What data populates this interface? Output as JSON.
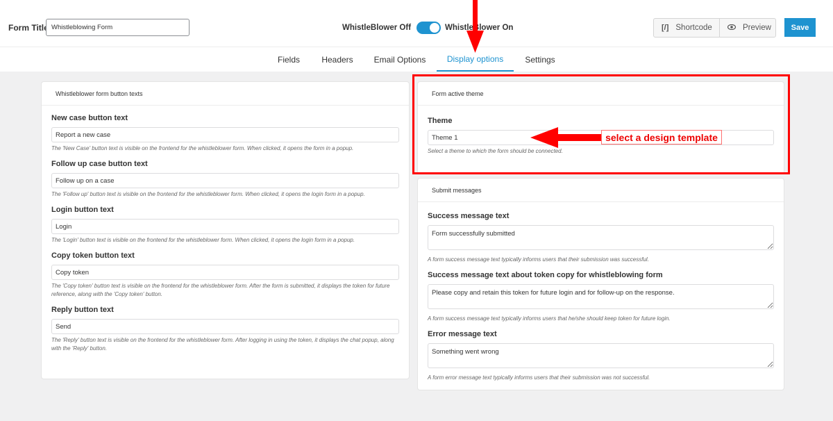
{
  "header": {
    "form_title_label": "Form Title",
    "form_title_value": "Whistleblowing Form",
    "toggle_off_label": "WhistleBlower Off",
    "toggle_on_label": "WhistleBlower On",
    "toggle_state": "on",
    "shortcode_icon": "[/]",
    "shortcode_label": "Shortcode",
    "preview_icon": "eye-icon",
    "preview_label": "Preview",
    "save_label": "Save"
  },
  "tabs": [
    {
      "label": "Fields",
      "active": false
    },
    {
      "label": "Headers",
      "active": false
    },
    {
      "label": "Email Options",
      "active": false
    },
    {
      "label": "Display options",
      "active": true
    },
    {
      "label": "Settings",
      "active": false
    }
  ],
  "button_texts": {
    "title": "Whistleblower form button texts",
    "fields": [
      {
        "label": "New case button text",
        "value": "Report a new case",
        "help": "The 'New Case' button text is visible on the frontend for the whistleblower form. When clicked, it opens the form in a popup."
      },
      {
        "label": "Follow up case button text",
        "value": "Follow up on a case",
        "help": "The 'Follow up' button text is visible on the frontend for the whistleblower form. When clicked, it opens the login form in a popup."
      },
      {
        "label": "Login button text",
        "value": "Login",
        "help": "The 'Login' button text is visible on the frontend for the whistleblower form. When clicked, it opens the login form in a popup."
      },
      {
        "label": "Copy token button text",
        "value": "Copy token",
        "help": "The 'Copy token' button text is visible on the frontend for the whistleblower form. After the form is submitted, it displays the token for future reference, along with the 'Copy token' button."
      },
      {
        "label": "Reply button text",
        "value": "Send",
        "help": "The 'Reply' button text is visible on the frontend for the whistleblower form. After logging in using the token, it displays the chat popup, along with the 'Reply' button."
      }
    ]
  },
  "theme": {
    "title": "Form active theme",
    "label": "Theme",
    "value": "Theme 1",
    "help": "Select a theme to which the form should be connected."
  },
  "submit_messages": {
    "title": "Submit messages",
    "fields": [
      {
        "label": "Success message text",
        "value": "Form successfully submitted",
        "help": "A form success message text typically informs users that their submission was successful."
      },
      {
        "label": "Success message text about token copy for whistleblowing form",
        "value": "Please copy and retain this token for future login and for follow-up on the response.",
        "help": "A form success message text typically informs users that he/she should keep token for future login."
      },
      {
        "label": "Error message text",
        "value": "Something went wrong",
        "help": "A form error message text typically informs users that their submission was not successful."
      }
    ]
  },
  "annotation": {
    "label": "select a design template",
    "color": "#ff0000"
  },
  "colors": {
    "accent": "#1e93d0",
    "annotation": "#ff0000",
    "background": "#f0f0f1"
  }
}
